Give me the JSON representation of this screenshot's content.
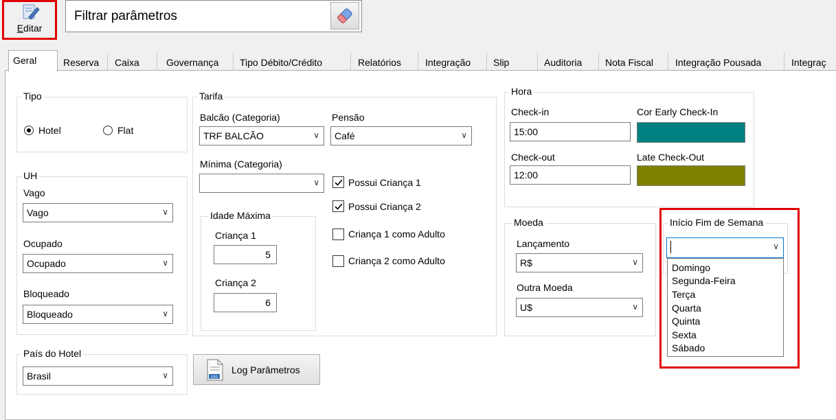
{
  "toolbar": {
    "edit_label_accel": "E",
    "edit_label_rest": "ditar",
    "filter_label": "Filtrar parâmetros"
  },
  "tabs": [
    "Geral",
    "Reserva",
    "Caixa",
    "Governança",
    "Tipo Débito/Crédito",
    "Relatórios",
    "Integração",
    "Slip",
    "Auditoria",
    "Nota Fiscal",
    "Integração Pousada",
    "Integraç"
  ],
  "tipo": {
    "legend": "Tipo",
    "hotel": "Hotel",
    "flat": "Flat",
    "selected": "Hotel"
  },
  "uh": {
    "legend": "UH",
    "vago_label": "Vago",
    "vago_value": "Vago",
    "ocupado_label": "Ocupado",
    "ocupado_value": "Ocupado",
    "bloqueado_label": "Bloqueado",
    "bloqueado_value": "Bloqueado"
  },
  "pais": {
    "legend": "País do Hotel",
    "value": "Brasil"
  },
  "tarifa": {
    "legend": "Tarifa",
    "balcao_label": "Balcão (Categoria)",
    "balcao_value": "TRF BALCÃO",
    "pensao_label": "Pensão",
    "pensao_value": "Café",
    "minima_label": "Mínima (Categoria)",
    "minima_value": "",
    "idade_legend": "Idade Máxima",
    "crianca1_label": "Criança 1",
    "crianca1_value": "5",
    "crianca2_label": "Criança 2",
    "crianca2_value": "6",
    "checks": [
      {
        "label": "Possui Criança 1",
        "checked": true
      },
      {
        "label": "Possui Criança 2",
        "checked": true
      },
      {
        "label": "Criança 1 como Adulto",
        "checked": false
      },
      {
        "label": "Criança 2 como Adulto",
        "checked": false
      }
    ]
  },
  "hora": {
    "legend": "Hora",
    "checkin_label": "Check-in",
    "checkin_value": "15:00",
    "checkout_label": "Check-out",
    "checkout_value": "12:00",
    "early_label": "Cor Early Check-In",
    "early_color": "#008080",
    "late_label": "Late Check-Out",
    "late_color": "#808000"
  },
  "moeda": {
    "legend": "Moeda",
    "lancamento_label": "Lançamento",
    "lancamento_value": "R$",
    "outra_label": "Outra Moeda",
    "outra_value": "U$"
  },
  "fim_semana": {
    "legend": "Início Fim de Semana",
    "value": "",
    "options": [
      "Domingo",
      "Segunda-Feira",
      "Terça",
      "Quarta",
      "Quinta",
      "Sexta",
      "Sábado"
    ]
  },
  "log_button": "Log Parâmetros",
  "colors": {
    "highlight": "#e00000",
    "early": "#008080",
    "late": "#808000"
  }
}
